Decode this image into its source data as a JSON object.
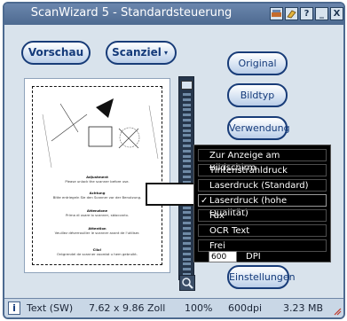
{
  "window": {
    "title": "ScanWizard 5 - Standardsteuerung"
  },
  "titlebar_buttons": {
    "help": "?",
    "minimize": "_",
    "close": "X"
  },
  "top_buttons": {
    "preview": "Vorschau",
    "scan_target": "Scanziel"
  },
  "side_buttons": {
    "original": "Original",
    "image_type": "Bildtyp",
    "usage": "Verwendung",
    "settings": "Einstellungen"
  },
  "usage_menu": {
    "items": [
      {
        "label": "Zur Anzeige am Bildschirm",
        "checked": false
      },
      {
        "label": "Tintenstrahldruck",
        "checked": false
      },
      {
        "label": "Laserdruck (Standard)",
        "checked": false
      },
      {
        "label": "Laserdruck (hohe Qualität)",
        "checked": true
      },
      {
        "label": "Fax",
        "checked": false
      },
      {
        "label": "OCR Text",
        "checked": false
      },
      {
        "label": "Frei",
        "checked": false
      }
    ],
    "checkmark": "✓",
    "dpi_value": "600",
    "dpi_unit": "DPI"
  },
  "status_bar": {
    "info_icon": "i",
    "mode": "Text (SW)",
    "size": "7.62 x 9.86 Zoll",
    "zoom": "100%",
    "resolution": "600dpi",
    "file_size": "3.23 MB"
  },
  "preview_document": {
    "lines": [
      "Adjustment",
      "Please unlock the scanner before use.",
      "Achtung",
      "Bitte entriegeln Sie den Scanner vor der Benutzung.",
      "Attenzione",
      "Prima di usare lo scanner, sbloccarlo.",
      "Attention",
      "Veuillez déverrouiller le scanner avant de l'utiliser.",
      "Cilo!",
      "Ontgrendel de scanner voordat u hem gebruikt."
    ]
  },
  "colors": {
    "frame": "#4d6a90",
    "button_text": "#143a7a",
    "menu_bg": "#000000"
  }
}
